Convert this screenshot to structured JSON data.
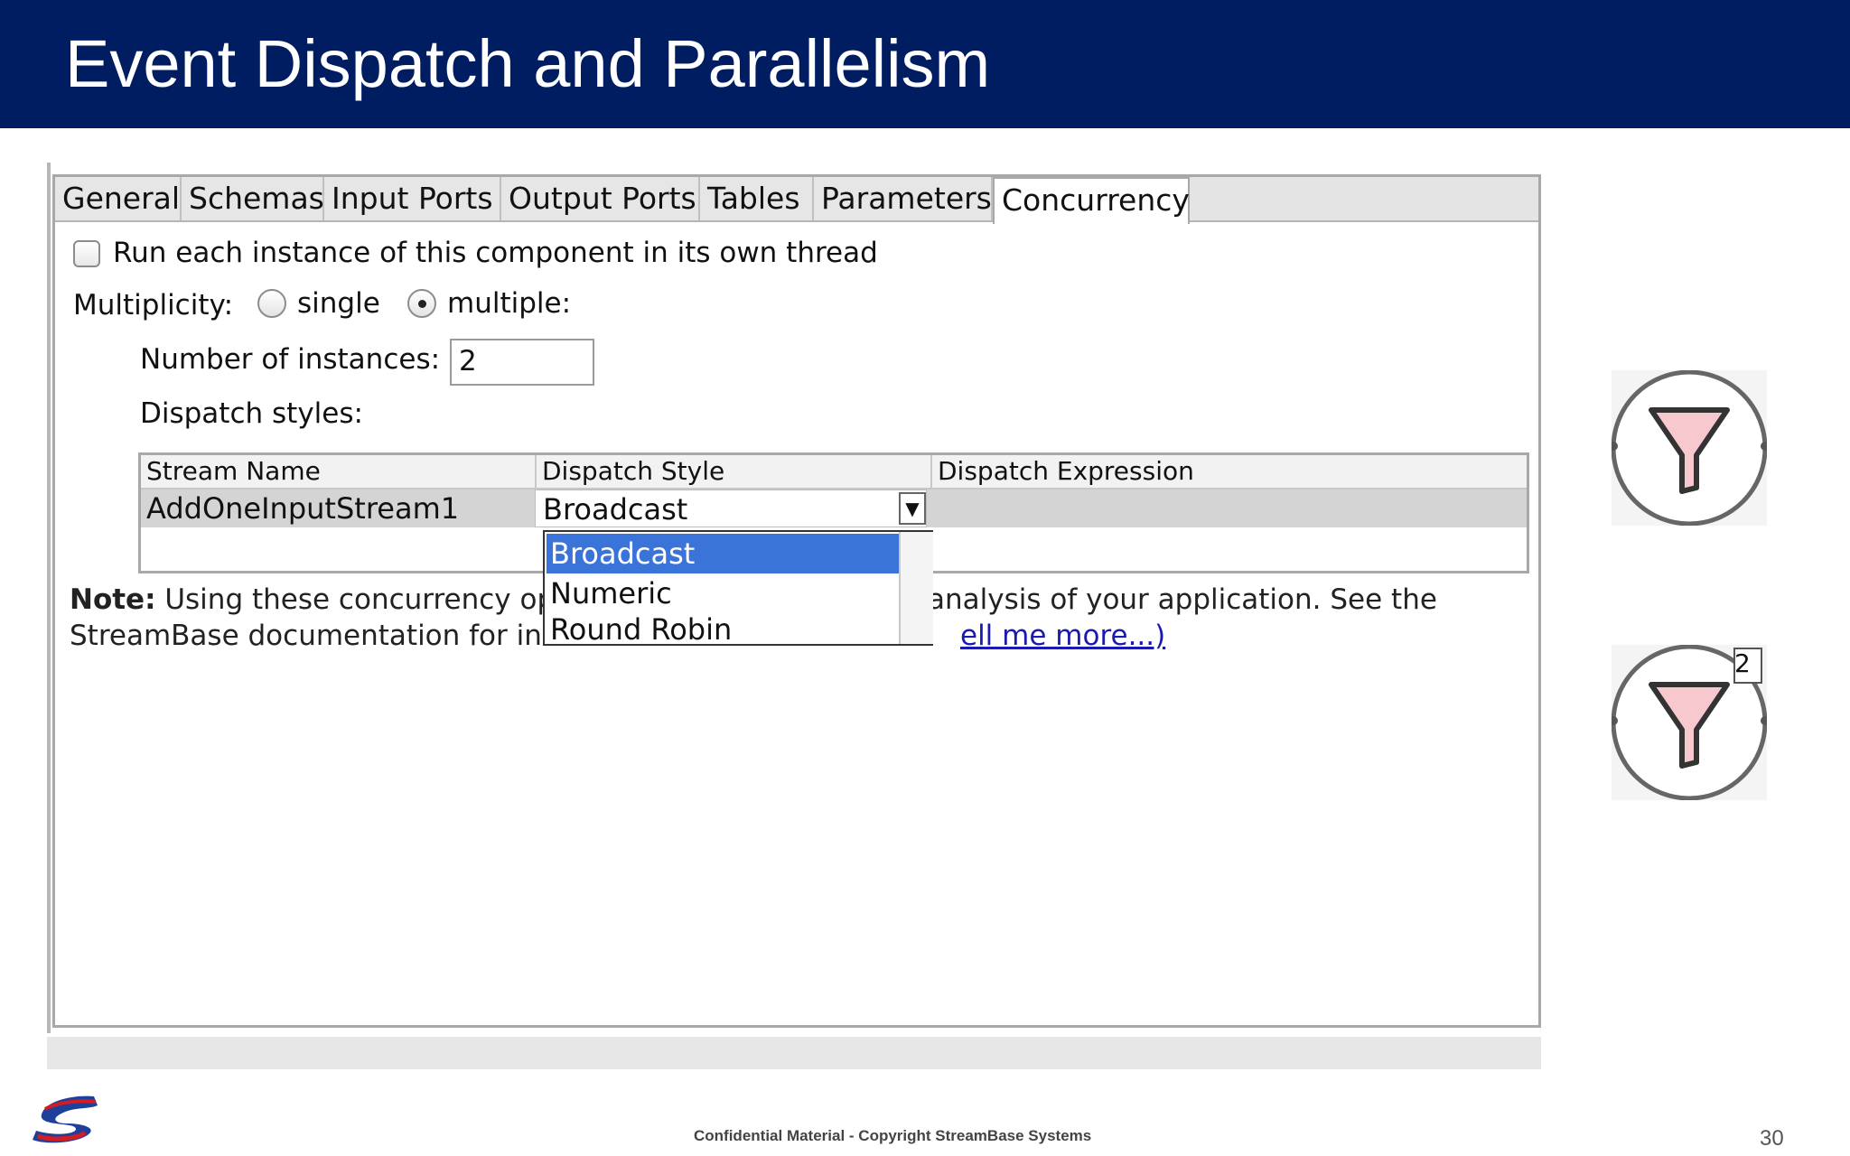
{
  "slide": {
    "title": "Event Dispatch and Parallelism",
    "footer": "Confidential Material - Copyright StreamBase Systems",
    "page_number": "30"
  },
  "dialog": {
    "tabs": [
      "General",
      "Schemas",
      "Input Ports",
      "Output Ports",
      "Tables",
      "Parameters",
      "Concurrency"
    ],
    "active_tab": "Concurrency",
    "thread_checkbox_label": "Run each instance of this component in its own thread",
    "thread_checkbox_checked": false,
    "multiplicity_label": "Multiplicity:",
    "multiplicity_options": [
      "single",
      "multiple:"
    ],
    "multiplicity_selected": "multiple:",
    "instances_label": "Number of instances:",
    "instances_value": "2",
    "dispatch_styles_label": "Dispatch styles:",
    "grid": {
      "headers": [
        "Stream Name",
        "Dispatch Style",
        "Dispatch Expression"
      ],
      "rows": [
        {
          "stream_name": "AddOneInputStream1",
          "dispatch_style": "Broadcast",
          "dispatch_expression": ""
        }
      ]
    },
    "dropdown": {
      "options": [
        "Broadcast",
        "Numeric",
        "Round Robin"
      ],
      "selected": "Broadcast"
    },
    "note": {
      "bold_prefix": "Note:",
      "line1_left": "Using these concurrency op",
      "line1_right": "analysis of your application. See the",
      "line2_left": "StreamBase documentation for in",
      "link_text": "ell me more...)"
    }
  },
  "operator_icons": [
    {
      "name": "filter-operator",
      "instances": ""
    },
    {
      "name": "filter-operator-parallel",
      "instances": "2"
    }
  ],
  "colors": {
    "title_bar": "#011d62",
    "selection": "#3b74d8",
    "link": "#1a1ab0"
  }
}
